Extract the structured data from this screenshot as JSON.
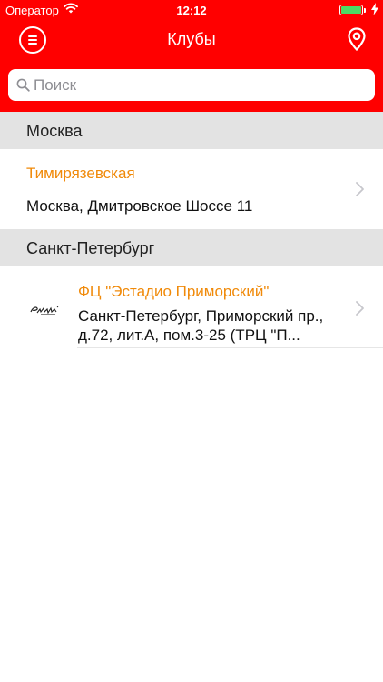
{
  "status_bar": {
    "carrier": "Оператор",
    "time": "12:12"
  },
  "header": {
    "title": "Клубы"
  },
  "search": {
    "placeholder": "Поиск"
  },
  "sections": [
    {
      "title": "Москва",
      "clubs": [
        {
          "name": "Тимирязевская",
          "address": "Москва, Дмитровское Шоссе 11"
        }
      ]
    },
    {
      "title": "Санкт-Петербург",
      "clubs": [
        {
          "name": "ФЦ \"Эстадио Приморский\"",
          "address": "Санкт-Петербург, Приморский пр., д.72, лит.А, пом.3-25 (ТРЦ \"П...",
          "logo_text": "Estadio"
        }
      ]
    }
  ],
  "colors": {
    "header_bg": "#ff0000",
    "club_name": "#f08a0a",
    "section_bg": "#e3e3e3",
    "battery": "#4cd964"
  },
  "icons": [
    "wifi-icon",
    "battery-icon",
    "charging-bolt-icon",
    "menu-icon",
    "location-pin-icon",
    "search-icon",
    "chevron-right-icon"
  ]
}
